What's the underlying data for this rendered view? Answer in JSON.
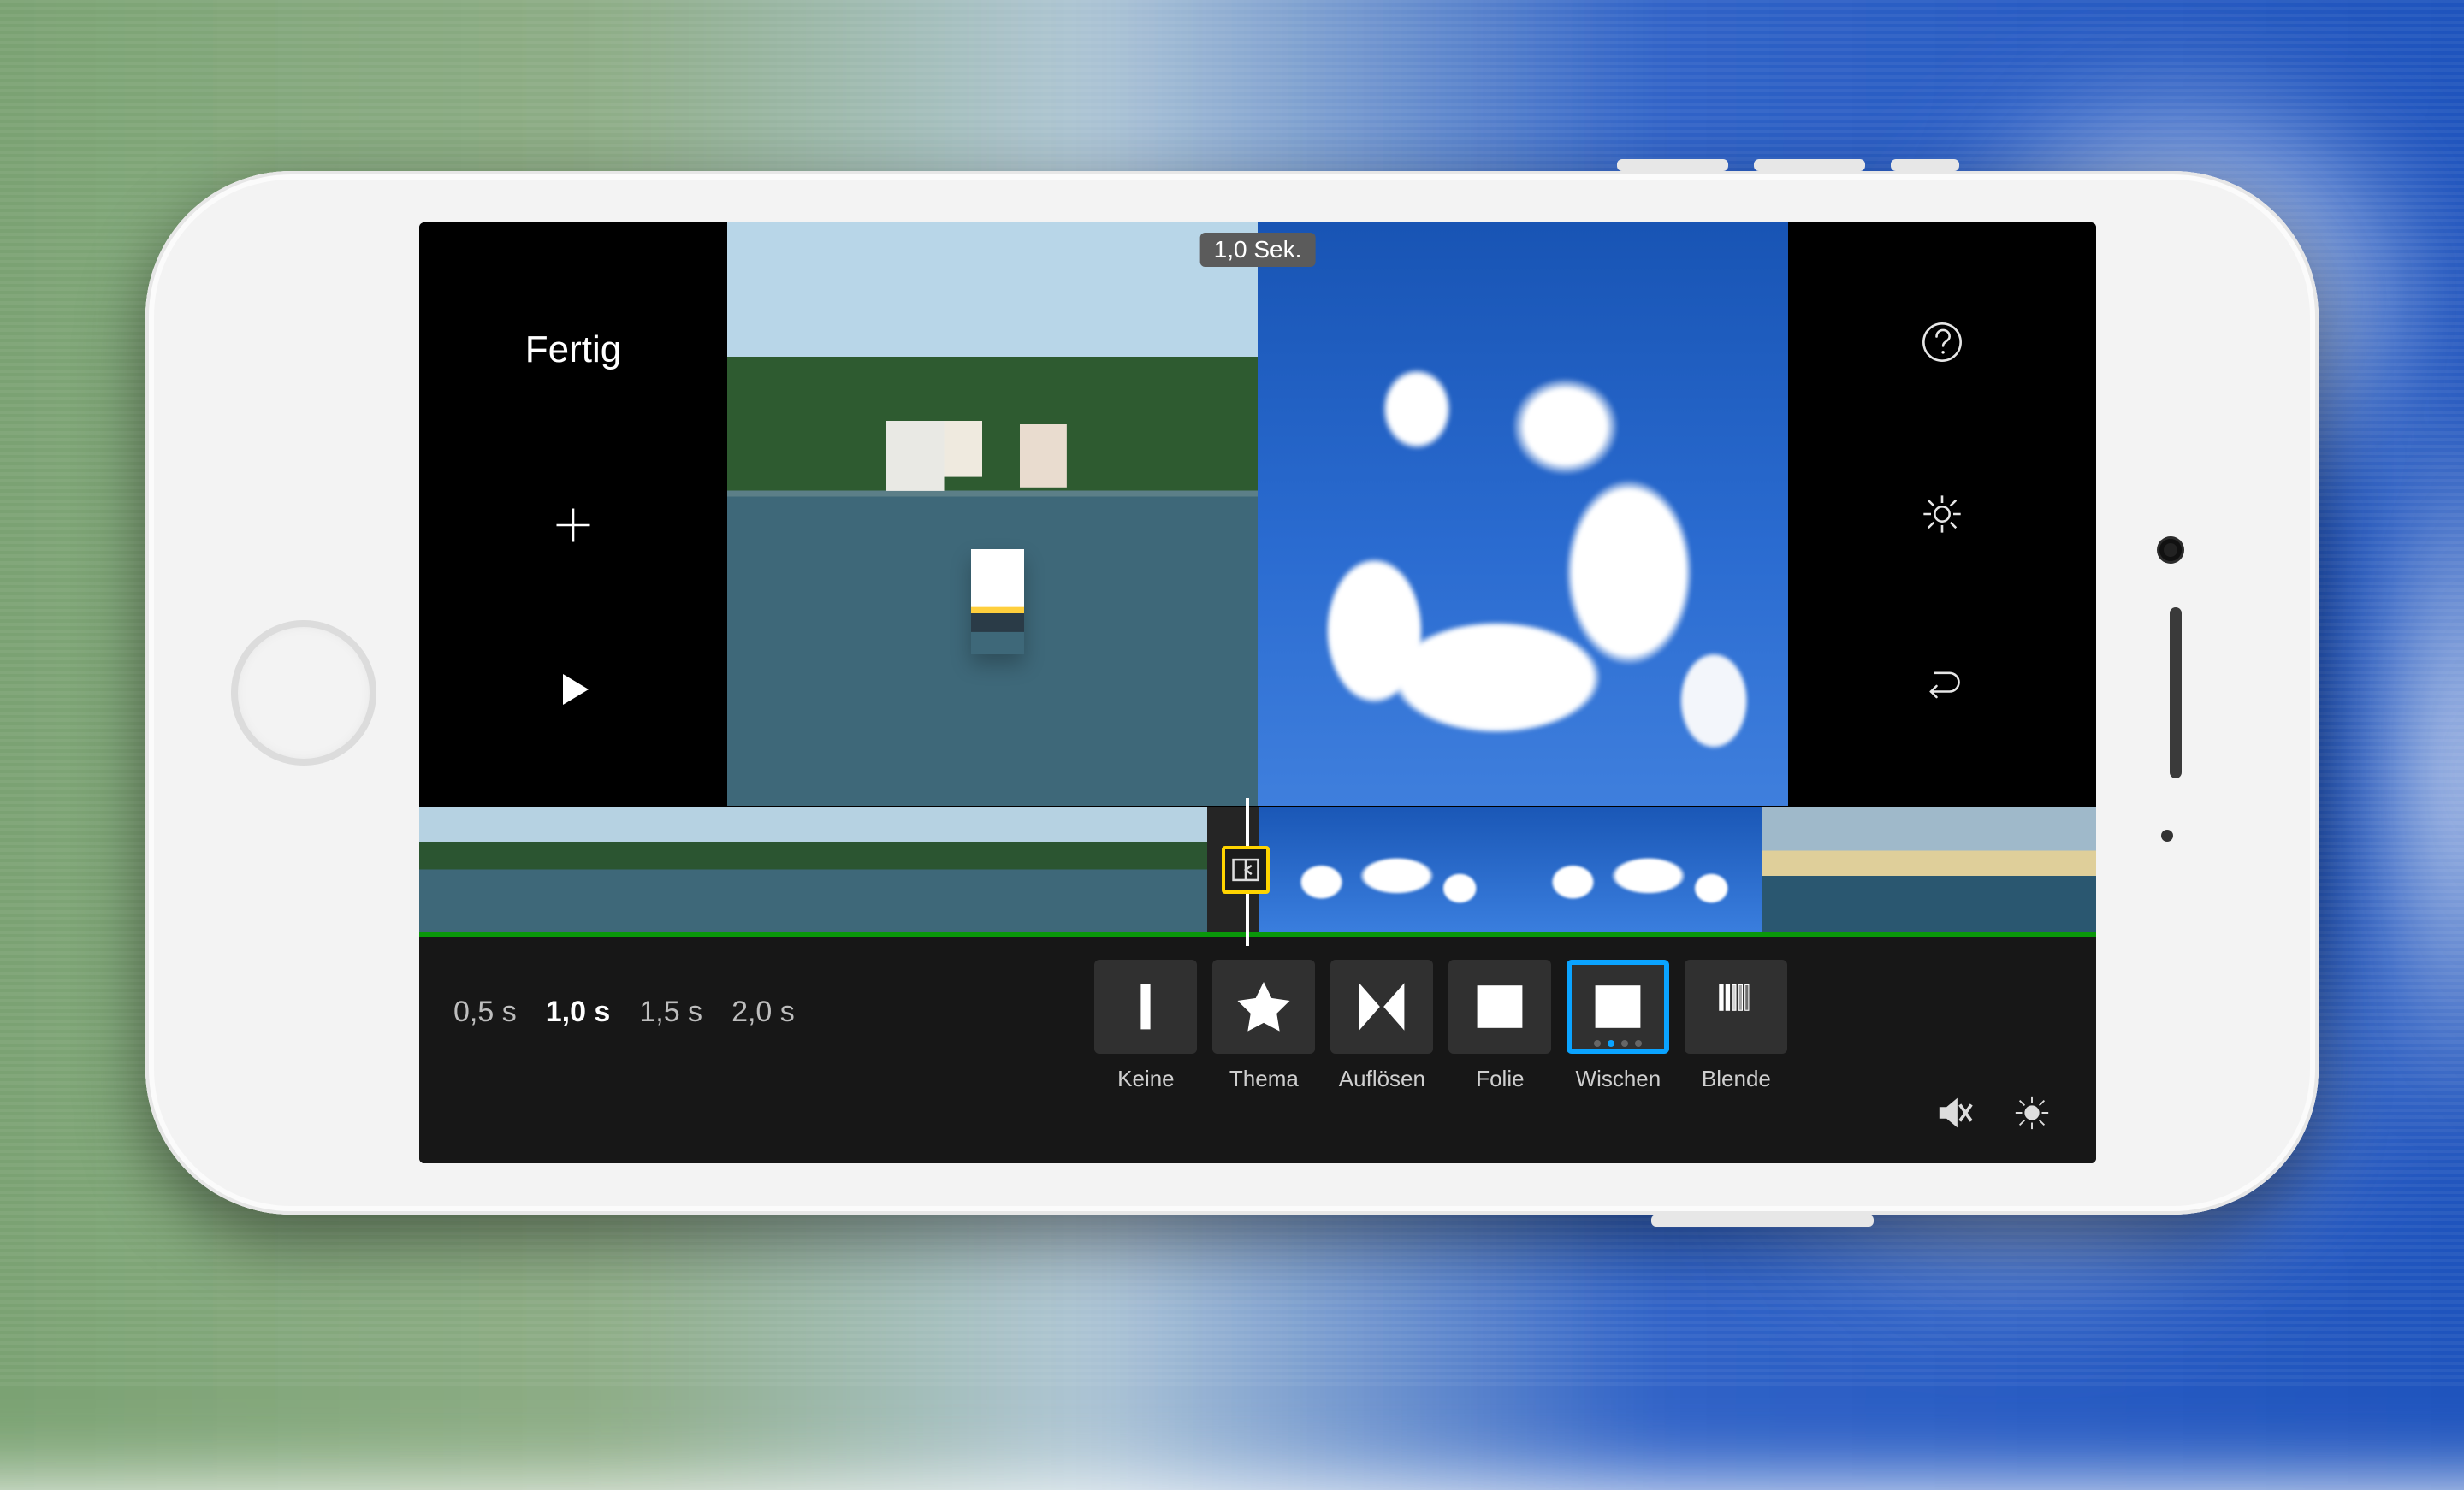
{
  "preview": {
    "duration_pill": "1,0 Sek.",
    "done_label": "Fertig"
  },
  "left_tools": {
    "add_label": "Hinzufügen",
    "play_label": "Abspielen"
  },
  "right_tools": {
    "help_label": "Hilfe",
    "settings_label": "Einstellungen",
    "undo_label": "Rückgängig"
  },
  "durations": {
    "options": [
      "0,5 s",
      "1,0 s",
      "1,5 s",
      "2,0 s"
    ],
    "selected_index": 1
  },
  "transitions": {
    "items": [
      {
        "id": "none",
        "label": "Keine"
      },
      {
        "id": "theme",
        "label": "Thema"
      },
      {
        "id": "dissolve",
        "label": "Auflösen"
      },
      {
        "id": "slide",
        "label": "Folie"
      },
      {
        "id": "wipe",
        "label": "Wischen"
      },
      {
        "id": "fade",
        "label": "Blende"
      }
    ],
    "selected_id": "wipe"
  },
  "bottom_right": {
    "mute_label": "Stumm",
    "clip_settings_label": "Clip-Einstellungen"
  },
  "timeline": {
    "transition_selected": true
  }
}
